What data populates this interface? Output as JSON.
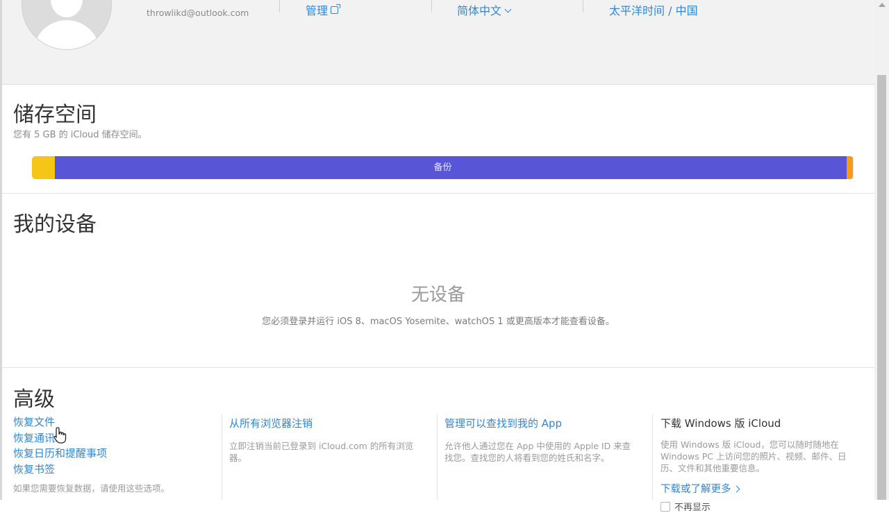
{
  "header": {
    "email": "throwlikd@outlook.com",
    "manage_label": "管理",
    "language_label": "简体中文",
    "timezone_label": "太平洋时间 / 中国"
  },
  "storage": {
    "title": "储存空间",
    "subtitle": "您有 5 GB 的 iCloud 储存空间。",
    "bar_label": "备份",
    "segments": [
      {
        "name": "yellow",
        "fraction": 0.028,
        "color": "#f5c518"
      },
      {
        "name": "backup",
        "fraction": 0.964,
        "color": "#5856d6"
      },
      {
        "name": "orange",
        "fraction": 0.008,
        "color": "#f59a1b"
      }
    ]
  },
  "devices": {
    "title": "我的设备",
    "empty_title": "无设备",
    "empty_subtitle": "您必须登录并运行 iOS 8、macOS Yosemite、watchOS 1 或更高版本才能查看设备。"
  },
  "advanced": {
    "title": "高级",
    "restore_links": [
      "恢复文件",
      "恢复通讯录",
      "恢复日历和提醒事项",
      "恢复书签"
    ],
    "restore_note": "如果您需要恢复数据，请使用这些选项。",
    "signout_title": "从所有浏览器注销",
    "signout_desc": "立即注销当前已登录到 iCloud.com 的所有浏览器。",
    "findapp_title": "管理可以查找到我的 App",
    "findapp_desc": "允许他人通过您在 App 中使用的 Apple ID 来查找您。查找您的人将看到您的姓氏和名字。",
    "windows_title": "下载 Windows 版 iCloud",
    "windows_desc": "使用 Windows 版 iCloud，您可以随时随地在 Windows PC 上访问您的照片、视频、邮件、日历、文件和其他重要信息。",
    "windows_link": "下载或了解更多",
    "dont_show": "不再显示"
  }
}
